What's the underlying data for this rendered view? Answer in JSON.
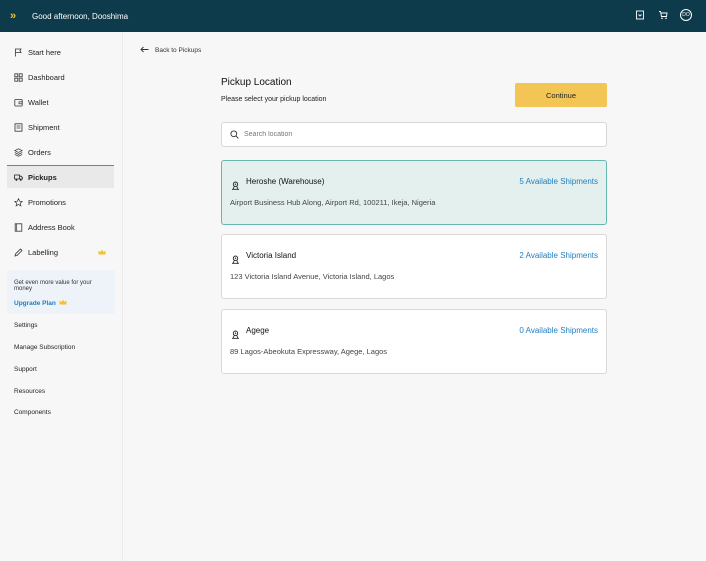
{
  "header": {
    "logo": "»",
    "greeting": "Good afternoon, Dooshima",
    "avatar_initials": "DO",
    "icons": [
      "bookmark-icon",
      "cart-icon"
    ]
  },
  "sidebar": {
    "items": [
      {
        "label": "Start here",
        "icon": "flag-icon"
      },
      {
        "label": "Dashboard",
        "icon": "dashboard-icon"
      },
      {
        "label": "Wallet",
        "icon": "wallet-icon"
      },
      {
        "label": "Shipment",
        "icon": "shipment-icon"
      },
      {
        "label": "Orders",
        "icon": "orders-icon"
      },
      {
        "label": "Pickups",
        "icon": "pickups-icon",
        "active": true
      },
      {
        "label": "Promotions",
        "icon": "star-icon"
      },
      {
        "label": "Address Book",
        "icon": "book-icon"
      },
      {
        "label": "Labelling",
        "icon": "pen-icon",
        "crown": true
      }
    ],
    "promo": {
      "text": "Get even more value for your money",
      "link": "Upgrade Plan"
    },
    "links": [
      "Settings",
      "Manage Subscription",
      "Support",
      "Resources",
      "Components"
    ]
  },
  "main": {
    "back_label": "Back to Pickups",
    "title": "Pickup Location",
    "subtitle": "Please select your pickup location",
    "continue_label": "Continue",
    "search_placeholder": "Search location",
    "locations": [
      {
        "name": "Heroshe (Warehouse)",
        "count": "5 Available Shipments",
        "address": "Airport Business Hub Along, Airport Rd, 100211, Ikeja, Nigeria",
        "selected": true
      },
      {
        "name": "Victoria Island",
        "count": "2 Available Shipments",
        "address": "123 Victoria Island Avenue, Victoria Island, Lagos",
        "selected": false
      },
      {
        "name": "Agege",
        "count": "0 Available Shipments",
        "address": "89 Lagos-Abeokuta Expressway, Agege, Lagos",
        "selected": false
      }
    ]
  },
  "colors": {
    "topbar": "#0e3b4b",
    "accent": "#f2c554",
    "link": "#1f7ec0",
    "selected_bg": "#e4f0ee",
    "selected_border": "#66b7ad"
  }
}
